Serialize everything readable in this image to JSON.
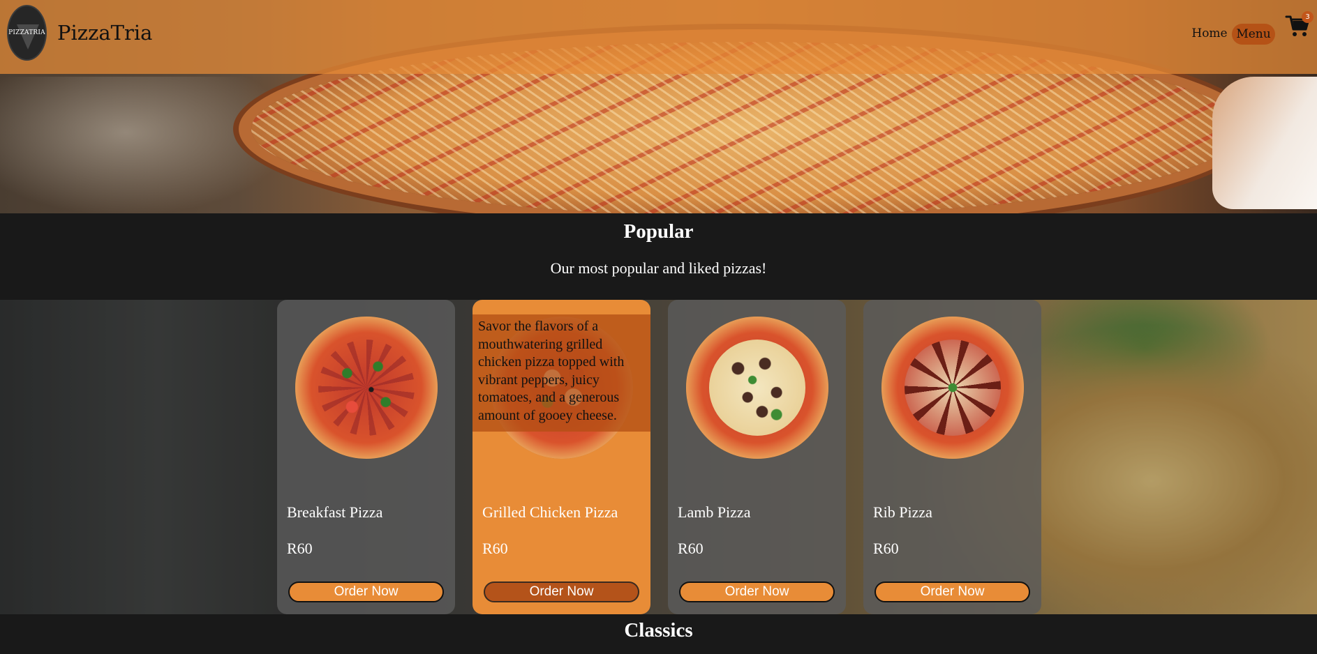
{
  "header": {
    "logo_text": "PIZZATRIA",
    "brand": "PizzaTria",
    "nav": {
      "home": "Home",
      "menu": "Menu"
    },
    "cart_count": "3"
  },
  "popular": {
    "title": "Popular",
    "subtitle": "Our most popular and liked pizzas!",
    "cards": [
      {
        "name": "Breakfast Pizza",
        "price": "R60",
        "button": "Order Now"
      },
      {
        "name": "Grilled Chicken Pizza",
        "price": "R60",
        "button": "Order Now",
        "description": "Savor the flavors of a mouthwatering grilled chicken pizza topped with vibrant peppers, juicy tomatoes, and a generous amount of gooey cheese."
      },
      {
        "name": "Lamb Pizza",
        "price": "R60",
        "button": "Order Now"
      },
      {
        "name": "Rib Pizza",
        "price": "R60",
        "button": "Order Now"
      }
    ]
  },
  "classics": {
    "title": "Classics"
  },
  "colors": {
    "accent": "#e88c37",
    "accent_dark": "#b4531a",
    "background": "#191919"
  },
  "icons": {
    "cart": "shopping-cart-icon"
  }
}
